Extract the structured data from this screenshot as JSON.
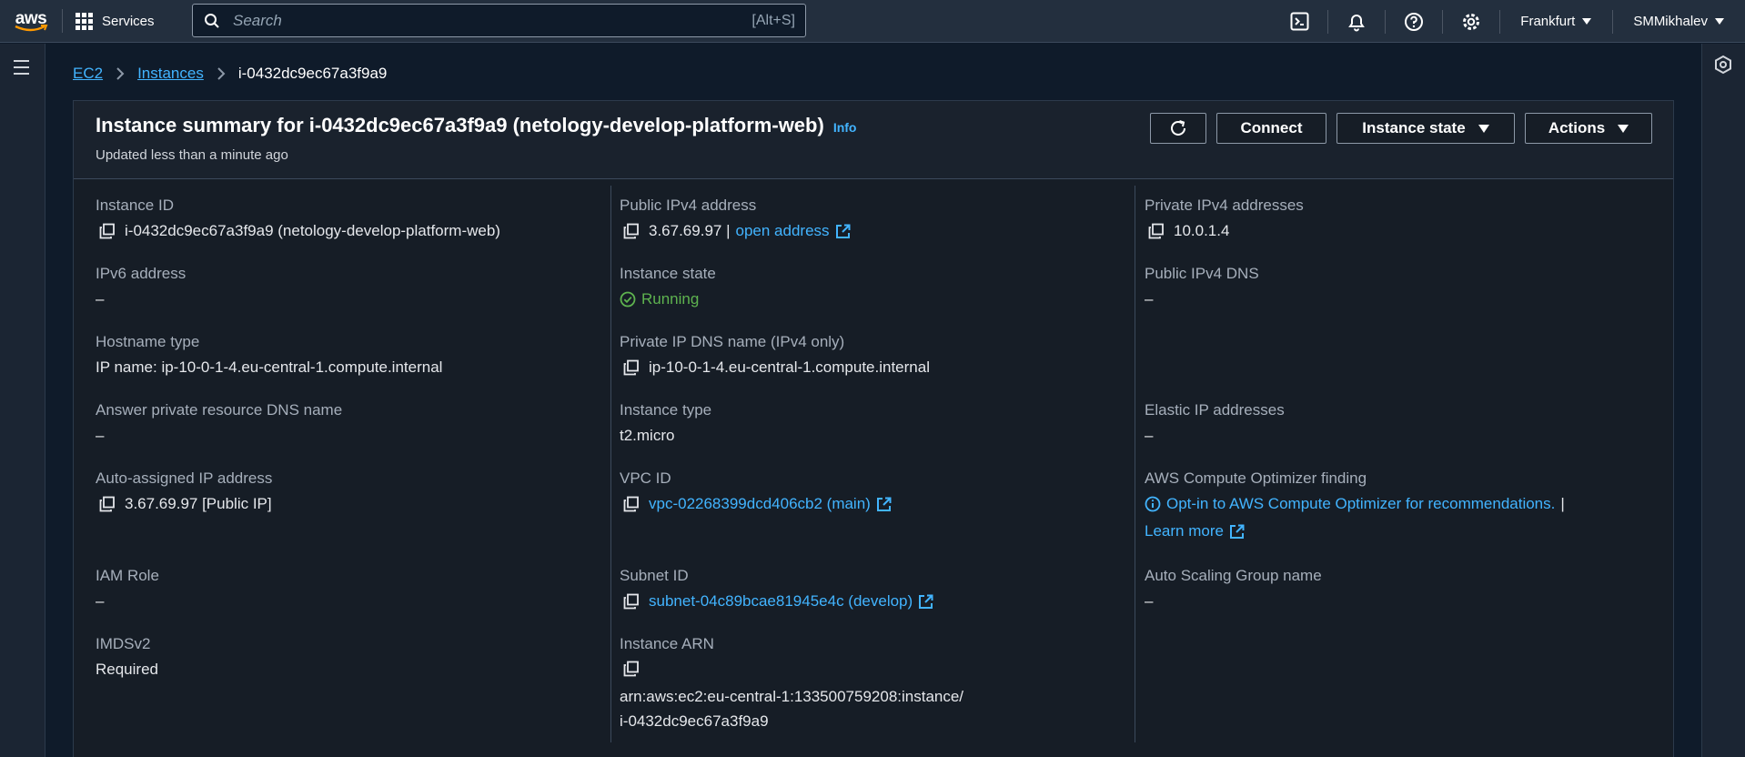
{
  "nav": {
    "logo_text": "aws",
    "services_label": "Services",
    "search_placeholder": "Search",
    "search_shortcut": "[Alt+S]",
    "region": "Frankfurt",
    "user": "SMMikhalev"
  },
  "breadcrumb": {
    "ec2": "EC2",
    "instances": "Instances",
    "current": "i-0432dc9ec67a3f9a9"
  },
  "summary": {
    "title": "Instance summary for i-0432dc9ec67a3f9a9 (netology-develop-platform-web)",
    "info": "Info",
    "updated": "Updated less than a minute ago",
    "connect_label": "Connect",
    "instance_state_label": "Instance state",
    "actions_label": "Actions"
  },
  "details": {
    "instance_id_label": "Instance ID",
    "instance_id_value": "i-0432dc9ec67a3f9a9 (netology-develop-platform-web)",
    "ipv6_label": "IPv6 address",
    "ipv6_value": "–",
    "hostname_type_label": "Hostname type",
    "hostname_type_value": "IP name: ip-10-0-1-4.eu-central-1.compute.internal",
    "answer_dns_label": "Answer private resource DNS name",
    "answer_dns_value": "–",
    "auto_ip_label": "Auto-assigned IP address",
    "auto_ip_value": "3.67.69.97 [Public IP]",
    "iam_role_label": "IAM Role",
    "iam_role_value": "–",
    "imdsv2_label": "IMDSv2",
    "imdsv2_value": "Required",
    "public_ipv4_label": "Public IPv4 address",
    "public_ipv4_value": "3.67.69.97 |",
    "open_address": "open address",
    "instance_state_label": "Instance state",
    "instance_state_value": "Running",
    "private_dns_label": "Private IP DNS name (IPv4 only)",
    "private_dns_value": "ip-10-0-1-4.eu-central-1.compute.internal",
    "instance_type_label": "Instance type",
    "instance_type_value": "t2.micro",
    "vpc_id_label": "VPC ID",
    "vpc_id_value": "vpc-02268399dcd406cb2 (main)",
    "subnet_id_label": "Subnet ID",
    "subnet_id_value": "subnet-04c89bcae81945e4c (develop)",
    "arn_label": "Instance ARN",
    "arn_line1": "arn:aws:ec2:eu-central-1:133500759208:instance/",
    "arn_line2": "i-0432dc9ec67a3f9a9",
    "private_ipv4_label": "Private IPv4 addresses",
    "private_ipv4_value": "10.0.1.4",
    "public_dns_label": "Public IPv4 DNS",
    "public_dns_value": "–",
    "elastic_ip_label": "Elastic IP addresses",
    "elastic_ip_value": "–",
    "optimizer_label": "AWS Compute Optimizer finding",
    "optimizer_link": "Opt-in to AWS Compute Optimizer for recommendations.",
    "optimizer_sep": "|",
    "learn_more": "Learn more",
    "asg_label": "Auto Scaling Group name",
    "asg_value": "–"
  },
  "colors": {
    "nav_bg": "#232f3e",
    "page_bg": "#0f1b2a",
    "link": "#42b4ff",
    "running": "#5eb34f"
  }
}
